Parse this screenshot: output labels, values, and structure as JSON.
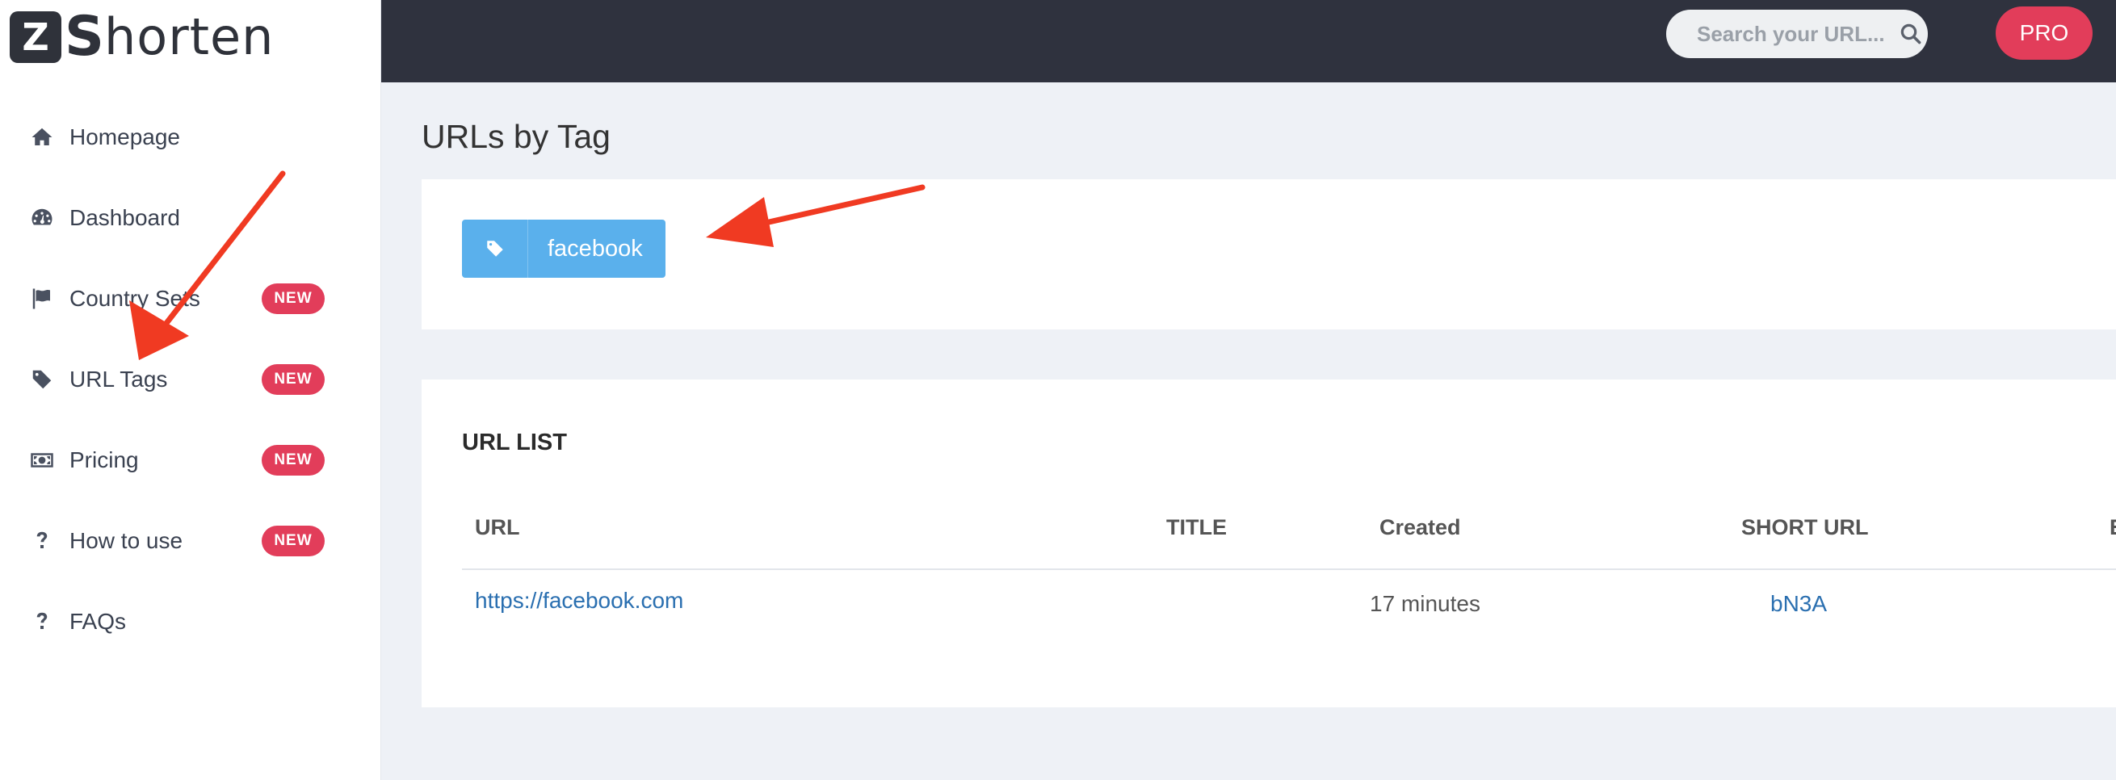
{
  "brand": {
    "mark": "Z",
    "s": "S",
    "rest": "horten"
  },
  "nav": [
    {
      "label": "Homepage",
      "icon": "home-icon",
      "badge": ""
    },
    {
      "label": "Dashboard",
      "icon": "dashboard-gauge-icon",
      "badge": ""
    },
    {
      "label": "Country Sets",
      "icon": "flag-icon",
      "badge": "NEW"
    },
    {
      "label": "URL Tags",
      "icon": "tag-icon",
      "badge": "NEW"
    },
    {
      "label": "Pricing",
      "icon": "money-bill-icon",
      "badge": "NEW"
    },
    {
      "label": "How to use",
      "icon": "question-icon",
      "badge": "NEW"
    },
    {
      "label": "FAQs",
      "icon": "question-icon",
      "badge": ""
    }
  ],
  "topbar": {
    "search_placeholder": "Search your URL...",
    "pro_label": "PRO"
  },
  "page": {
    "title": "URLs by Tag"
  },
  "tag": {
    "label": "facebook"
  },
  "list": {
    "title": "URL LIST",
    "columns": [
      "URL",
      "TITLE",
      "Created",
      "SHORT URL",
      "E"
    ],
    "rows": [
      {
        "url": "https://facebook.com",
        "title": "",
        "created": "17 minutes",
        "short": "bN3A"
      }
    ]
  },
  "colors": {
    "accent": "#e23d5a",
    "topbar": "#2f323e",
    "tag": "#5ab0ec",
    "link": "#2a6fb0",
    "arrow": "#f03a22"
  }
}
